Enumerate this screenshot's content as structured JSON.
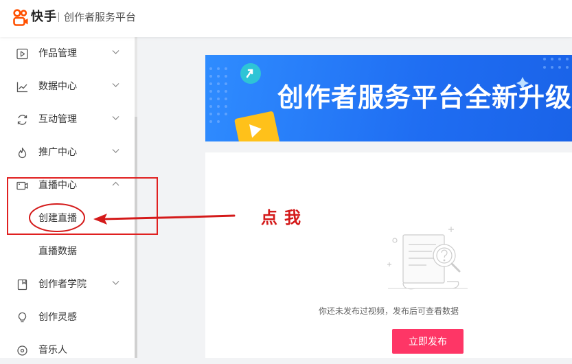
{
  "header": {
    "brand": "快手",
    "subtitle": "创作者服务平台"
  },
  "sidebar": {
    "items": [
      {
        "label": "作品管理",
        "icon": "play-square-icon",
        "expanded": false
      },
      {
        "label": "数据中心",
        "icon": "line-chart-icon",
        "expanded": false
      },
      {
        "label": "互动管理",
        "icon": "interaction-icon",
        "expanded": false
      },
      {
        "label": "推广中心",
        "icon": "flame-icon",
        "expanded": false
      },
      {
        "label": "直播中心",
        "icon": "video-camera-icon",
        "expanded": true,
        "children": [
          {
            "label": "创建直播"
          },
          {
            "label": "直播数据"
          }
        ]
      },
      {
        "label": "创作者学院",
        "icon": "book-icon",
        "expanded": false
      },
      {
        "label": "创作灵感",
        "icon": "lightbulb-icon"
      },
      {
        "label": "音乐人",
        "icon": "music-disc-icon"
      }
    ]
  },
  "banner": {
    "title": "创作者服务平台全新升级"
  },
  "main": {
    "empty_text": "你还未发布过视频，发布后可查看数据",
    "publish_label": "立即发布"
  },
  "annotation": {
    "text": "点我"
  },
  "colors": {
    "accent": "#fe3666",
    "logo": "#ff5000",
    "banner": "#1f6df2",
    "annotation": "#e02020"
  }
}
